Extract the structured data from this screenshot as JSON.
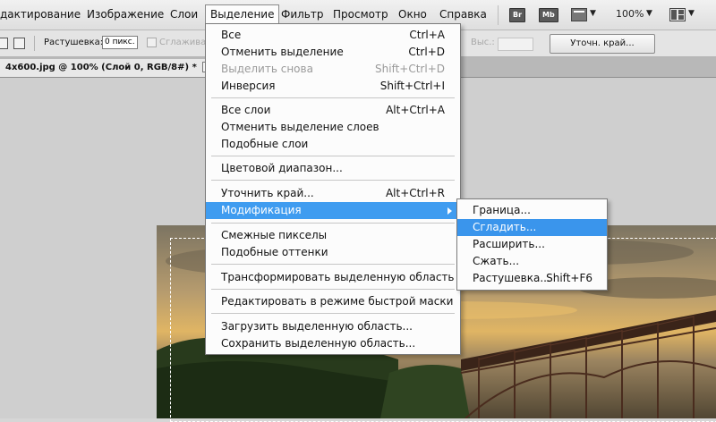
{
  "menubar": {
    "items": [
      "дактирование",
      "Изображение",
      "Слои",
      "Выделение",
      "Фильтр",
      "Просмотр",
      "Окно",
      "Справка"
    ],
    "app_icons": [
      "Br",
      "Mb"
    ],
    "zoom": "100%"
  },
  "options_bar": {
    "feather_label": "Растушевка:",
    "feather_value": "0 пикс.",
    "antialias_label": "Сглажива",
    "height_label": "Выс.:",
    "refine_edge_button": "Уточн. край..."
  },
  "document_tab": {
    "title": "4x600.jpg @ 100% (Слой 0, RGB/8#) *",
    "close": "×"
  },
  "select_menu": {
    "items": [
      {
        "label": "Все",
        "shortcut": "Ctrl+A",
        "disabled": false
      },
      {
        "label": "Отменить выделение",
        "shortcut": "Ctrl+D",
        "disabled": false
      },
      {
        "label": "Выделить снова",
        "shortcut": "Shift+Ctrl+D",
        "disabled": true
      },
      {
        "label": "Инверсия",
        "shortcut": "Shift+Ctrl+I",
        "disabled": false
      },
      {
        "label": "Все слои",
        "shortcut": "Alt+Ctrl+A",
        "disabled": false
      },
      {
        "label": "Отменить выделение слоев",
        "shortcut": "",
        "disabled": false
      },
      {
        "label": "Подобные слои",
        "shortcut": "",
        "disabled": false
      },
      {
        "label": "Цветовой диапазон...",
        "shortcut": "",
        "disabled": false
      },
      {
        "label": "Уточнить край...",
        "shortcut": "Alt+Ctrl+R",
        "disabled": false
      },
      {
        "label": "Модификация",
        "shortcut": "",
        "disabled": false
      },
      {
        "label": "Смежные пикселы",
        "shortcut": "",
        "disabled": false
      },
      {
        "label": "Подобные оттенки",
        "shortcut": "",
        "disabled": false
      },
      {
        "label": "Трансформировать выделенную область",
        "shortcut": "",
        "disabled": false
      },
      {
        "label": "Редактировать в режиме быстрой маски",
        "shortcut": "",
        "disabled": false
      },
      {
        "label": "Загрузить выделенную область...",
        "shortcut": "",
        "disabled": false
      },
      {
        "label": "Сохранить выделенную область...",
        "shortcut": "",
        "disabled": false
      }
    ]
  },
  "modify_submenu": {
    "items": [
      {
        "label": "Граница...",
        "shortcut": ""
      },
      {
        "label": "Сгладить...",
        "shortcut": ""
      },
      {
        "label": "Расширить...",
        "shortcut": ""
      },
      {
        "label": "Сжать...",
        "shortcut": ""
      },
      {
        "label": "Растушевка...",
        "shortcut": "Shift+F6"
      }
    ]
  },
  "colors": {
    "highlight": "#3f9cf0",
    "menu_bg": "#fcfcfc"
  }
}
